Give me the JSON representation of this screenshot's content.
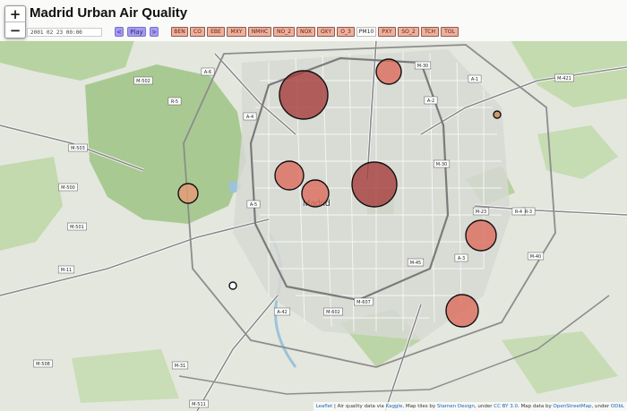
{
  "title": "Madrid Urban Air Quality",
  "zoom": {
    "in": "+",
    "out": "−"
  },
  "timestamp": "2001 02 23 00:00",
  "controls": {
    "prev": "<",
    "play": "Play",
    "next": ">"
  },
  "pollutants": [
    "BEN",
    "CO",
    "EBE",
    "MXY",
    "NMHC",
    "NO_2",
    "NOX",
    "OXY",
    "O_3",
    "PM10",
    "PXY",
    "SO_2",
    "TCH",
    "TOL"
  ],
  "selected_pollutant": "PM10",
  "city_label": "Madrid",
  "road_labels": [
    "M-30",
    "A-1",
    "A-2",
    "A-3",
    "A-4",
    "A-5",
    "A-6",
    "A-42",
    "M-11",
    "M-40",
    "M-30",
    "M-23",
    "R-3",
    "R-5",
    "M-500",
    "M-501",
    "M-502",
    "M-503",
    "M-508",
    "M-511",
    "M-602",
    "M-607",
    "M-45",
    "M-31",
    "M-421",
    "R-4"
  ],
  "stations": [
    {
      "name": "station-1",
      "level": "very-high"
    },
    {
      "name": "station-2",
      "level": "very-high"
    },
    {
      "name": "station-3",
      "level": "high"
    },
    {
      "name": "station-4",
      "level": "high"
    },
    {
      "name": "station-5",
      "level": "high"
    },
    {
      "name": "station-6",
      "level": "high"
    },
    {
      "name": "station-7",
      "level": "high"
    },
    {
      "name": "station-8",
      "level": "medium"
    },
    {
      "name": "station-9",
      "level": "low"
    },
    {
      "name": "station-10",
      "level": "none"
    },
    {
      "name": "station-11",
      "level": "none"
    }
  ],
  "attribution": {
    "leaflet": "Leaflet",
    "p1": " | Air quality data via ",
    "kaggle": "Kaggle",
    "p2": ", Map tiles by ",
    "stamen": "Stamen Design",
    "p3": ", under ",
    "ccby": "CC BY 3.0",
    "p4": ". Map data by ",
    "osm": "OpenStreetMap",
    "p5": ", under ",
    "odbl": "ODbL"
  },
  "colors": {
    "very_high": "#a53c3c",
    "high": "#dc6b5c",
    "medium": "#e79a74",
    "low": "#c98a56",
    "marker_stroke": "#111111"
  }
}
